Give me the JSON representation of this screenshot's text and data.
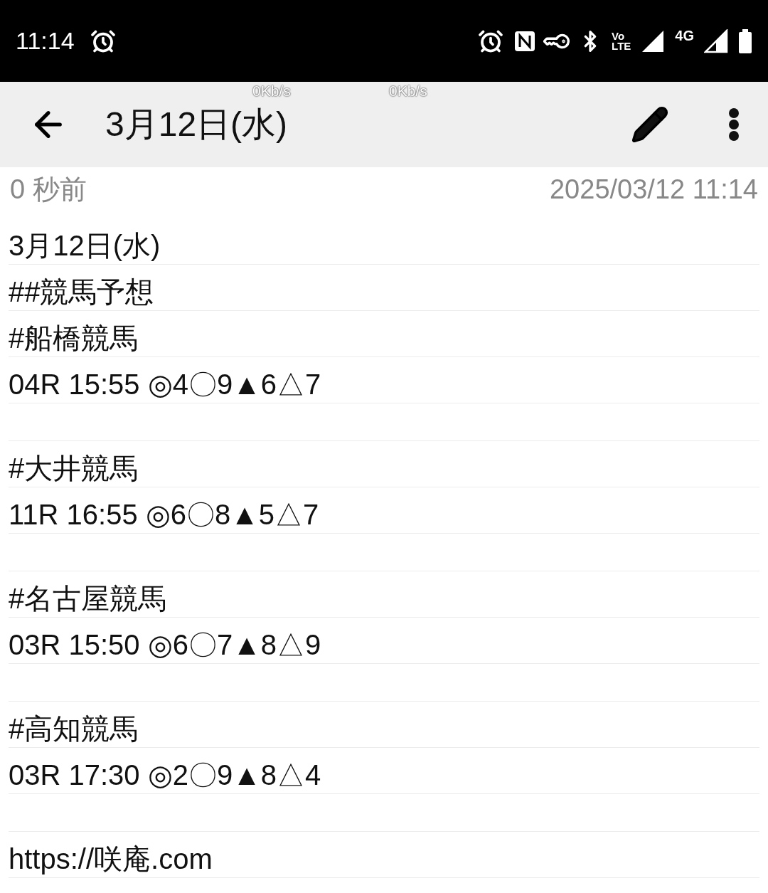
{
  "status_bar": {
    "time": "11:14",
    "volte_top": "Vo",
    "volte_bottom": "LTE",
    "network": "4G"
  },
  "speed_overlays": [
    "0Kb/s",
    "0Kb/s"
  ],
  "toolbar": {
    "title": "3月12日(水)"
  },
  "meta": {
    "relative_time": "0 秒前",
    "timestamp": "2025/03/12 11:14"
  },
  "lines": [
    {
      "kind": "text",
      "text": "3月12日(水)"
    },
    {
      "kind": "text",
      "text": "##競馬予想"
    },
    {
      "kind": "text",
      "text": "#船橋競馬"
    },
    {
      "kind": "text",
      "text": "04R 15:55 ◎4〇9▲6△7"
    },
    {
      "kind": "blank"
    },
    {
      "kind": "text",
      "text": "#大井競馬"
    },
    {
      "kind": "text",
      "text": "11R 16:55 ◎6〇8▲5△7"
    },
    {
      "kind": "blank"
    },
    {
      "kind": "text",
      "text": "#名古屋競馬"
    },
    {
      "kind": "text",
      "text": "03R 15:50 ◎6〇7▲8△9"
    },
    {
      "kind": "blank"
    },
    {
      "kind": "text",
      "text": "#高知競馬"
    },
    {
      "kind": "text",
      "text": "03R 17:30 ◎2〇9▲8△4"
    },
    {
      "kind": "blank"
    },
    {
      "kind": "text",
      "text": "https://咲庵.com"
    }
  ]
}
